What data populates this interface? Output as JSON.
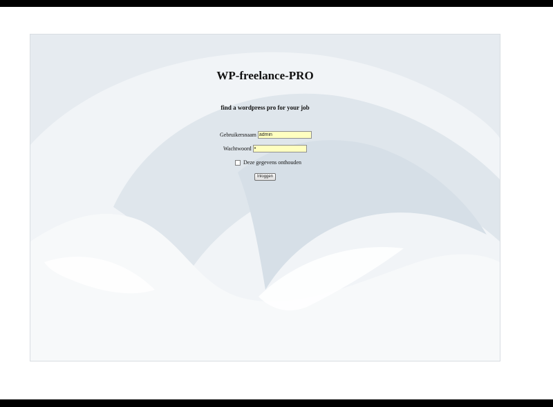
{
  "page": {
    "title": "WP-freelance-PRO",
    "subtitle": "find a wordpress pro for your job"
  },
  "login_form": {
    "username_label": "Gebruikersnaam",
    "username_value": "admin",
    "password_label": "Wachtwoord",
    "password_value": "•",
    "remember_label": "Deze gegevens onthouden",
    "remember_checked": false,
    "submit_label": "Inloggen"
  },
  "colors": {
    "panel_background": "#f1f4f7",
    "field_background": "#ffffc0",
    "frame_bars": "#000000"
  }
}
